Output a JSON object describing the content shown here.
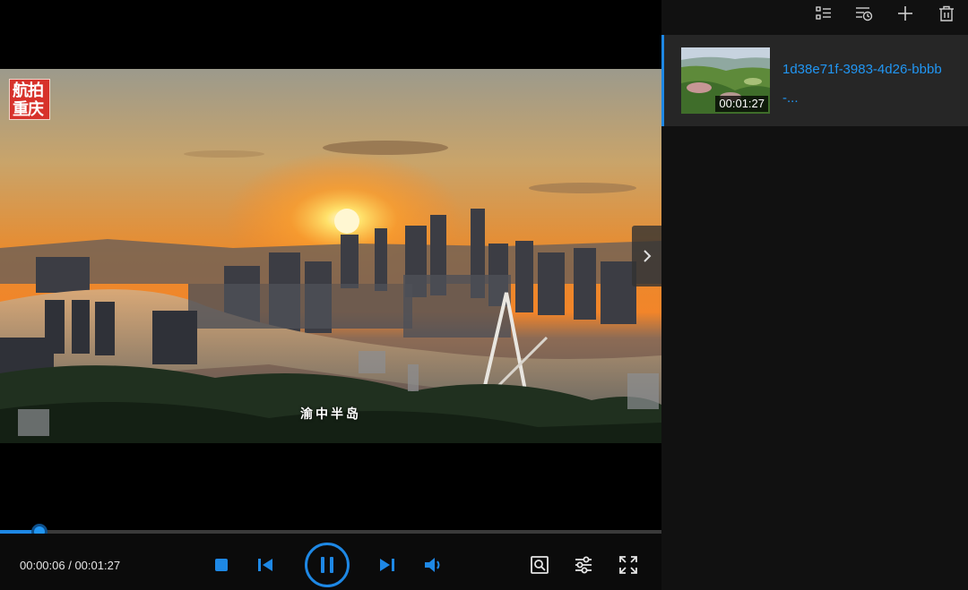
{
  "video": {
    "logo_text": "航拍重庆",
    "caption": "渝中半岛"
  },
  "player": {
    "current_time": "00:00:06",
    "total_time": "00:01:27",
    "time_separator": " / ",
    "progress_fraction": 0.06
  },
  "controls": {
    "stop": "stop-icon",
    "previous": "skip-previous-icon",
    "play_pause": "pause-icon",
    "next": "skip-next-icon",
    "volume": "volume-icon",
    "snapshot": "screenshot-icon",
    "settings": "sliders-icon",
    "fullscreen": "fullscreen-icon"
  },
  "playlist": {
    "toolbar": [
      "list-icon",
      "sort-clock-icon",
      "add-icon",
      "trash-icon"
    ],
    "items": [
      {
        "title": "1d38e71f-3983-4d26-bbbb-...",
        "duration": "00:01:27",
        "active": true
      }
    ]
  },
  "colors": {
    "accent": "#1e88e5",
    "background": "#000000",
    "panel": "#111111",
    "item_selected": "#262626"
  }
}
